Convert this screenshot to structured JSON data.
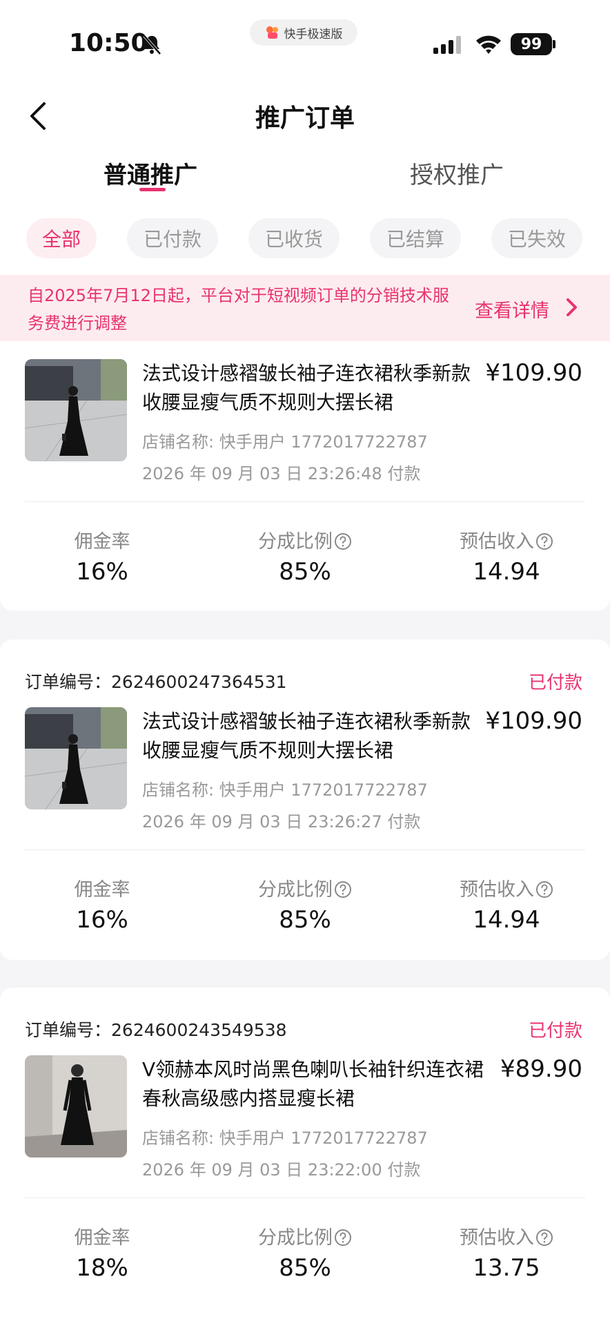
{
  "status_bar": {
    "time": "10:50",
    "app_name": "快手极速版",
    "battery": "99"
  },
  "header": {
    "title": "推广订单"
  },
  "tabs": [
    {
      "label": "普通推广",
      "active": true
    },
    {
      "label": "授权推广",
      "active": false
    }
  ],
  "filters": [
    "全部",
    "已付款",
    "已收货",
    "已结算",
    "已失效"
  ],
  "notice": {
    "text": "自2025年7月12日起，平台对于短视频订单的分销技术服务费进行调整",
    "link": "查看详情"
  },
  "stat_labels": {
    "commission_rate": "佣金率",
    "share_ratio": "分成比例",
    "estimated_income": "预估收入"
  },
  "orders": [
    {
      "title": "法式设计感褶皱长袖子连衣裙秋季新款收腰显瘦气质不规则大摆长裙",
      "price": "¥109.90",
      "shop": "店铺名称: 快手用户 1772017722787",
      "pay_time": "2026 年 09 月 03 日 23:26:48 付款",
      "commission_rate": "16%",
      "share_ratio": "85%",
      "estimated_income": "14.94"
    },
    {
      "order_label": "订单编号：",
      "order_no": "2624600247364531",
      "status": "已付款",
      "title": "法式设计感褶皱长袖子连衣裙秋季新款收腰显瘦气质不规则大摆长裙",
      "price": "¥109.90",
      "shop": "店铺名称: 快手用户 1772017722787",
      "pay_time": "2026 年 09 月 03 日 23:26:27 付款",
      "commission_rate": "16%",
      "share_ratio": "85%",
      "estimated_income": "14.94"
    },
    {
      "order_label": "订单编号：",
      "order_no": "2624600243549538",
      "status": "已付款",
      "title": "V领赫本风时尚黑色喇叭长袖针织连衣裙春秋高级感内搭显瘦长裙",
      "price": "¥89.90",
      "shop": "店铺名称: 快手用户 1772017722787",
      "pay_time": "2026 年 09 月 03 日 23:22:00 付款",
      "commission_rate": "18%",
      "share_ratio": "85%",
      "estimated_income": "13.75"
    }
  ],
  "colors": {
    "accent": "#e8336e",
    "notice_bg": "#fdecef"
  }
}
